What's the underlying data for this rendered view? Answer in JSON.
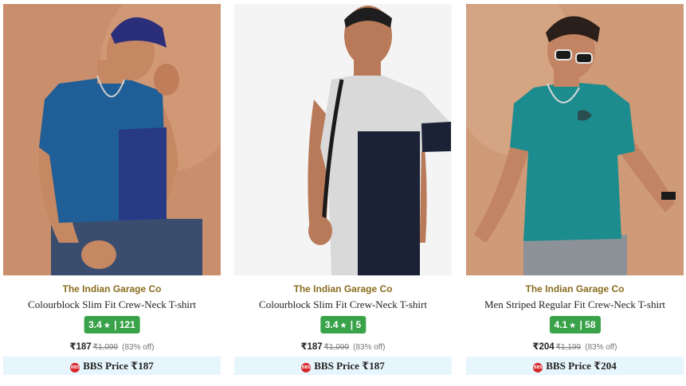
{
  "products": [
    {
      "brand": "The Indian Garage Co",
      "title": "Colourblock Slim Fit Crew-Neck T-shirt",
      "rating": "3.4",
      "reviews": "121",
      "price": "₹187",
      "mrp": "₹1,099",
      "discount": "(83% off)",
      "bbs_label": "BBS Price ₹187",
      "bbs_badge": "BBS",
      "colors": {
        "bg": "#c98f6c",
        "shirt_a": "#1f5e96",
        "shirt_b": "#283a85"
      }
    },
    {
      "brand": "The Indian Garage Co",
      "title": "Colourblock Slim Fit Crew-Neck T-shirt",
      "rating": "3.4",
      "reviews": "5",
      "price": "₹187",
      "mrp": "₹1,099",
      "discount": "(83% off)",
      "bbs_label": "BBS Price ₹187",
      "bbs_badge": "BBS",
      "colors": {
        "bg": "#f4f4f4",
        "shirt_a": "#d9d9d9",
        "shirt_b": "#1b2236"
      }
    },
    {
      "brand": "The Indian Garage Co",
      "title": "Men Striped Regular Fit Crew-Neck T-shirt",
      "rating": "4.1",
      "reviews": "58",
      "price": "₹204",
      "mrp": "₹1,199",
      "discount": "(83% off)",
      "bbs_label": "BBS Price ₹204",
      "bbs_badge": "BBS",
      "colors": {
        "bg": "#cf9a78",
        "shirt_a": "#1d8c8e",
        "shirt_b": "#167477"
      }
    }
  ],
  "rating_star": "★",
  "rating_sep": "|"
}
